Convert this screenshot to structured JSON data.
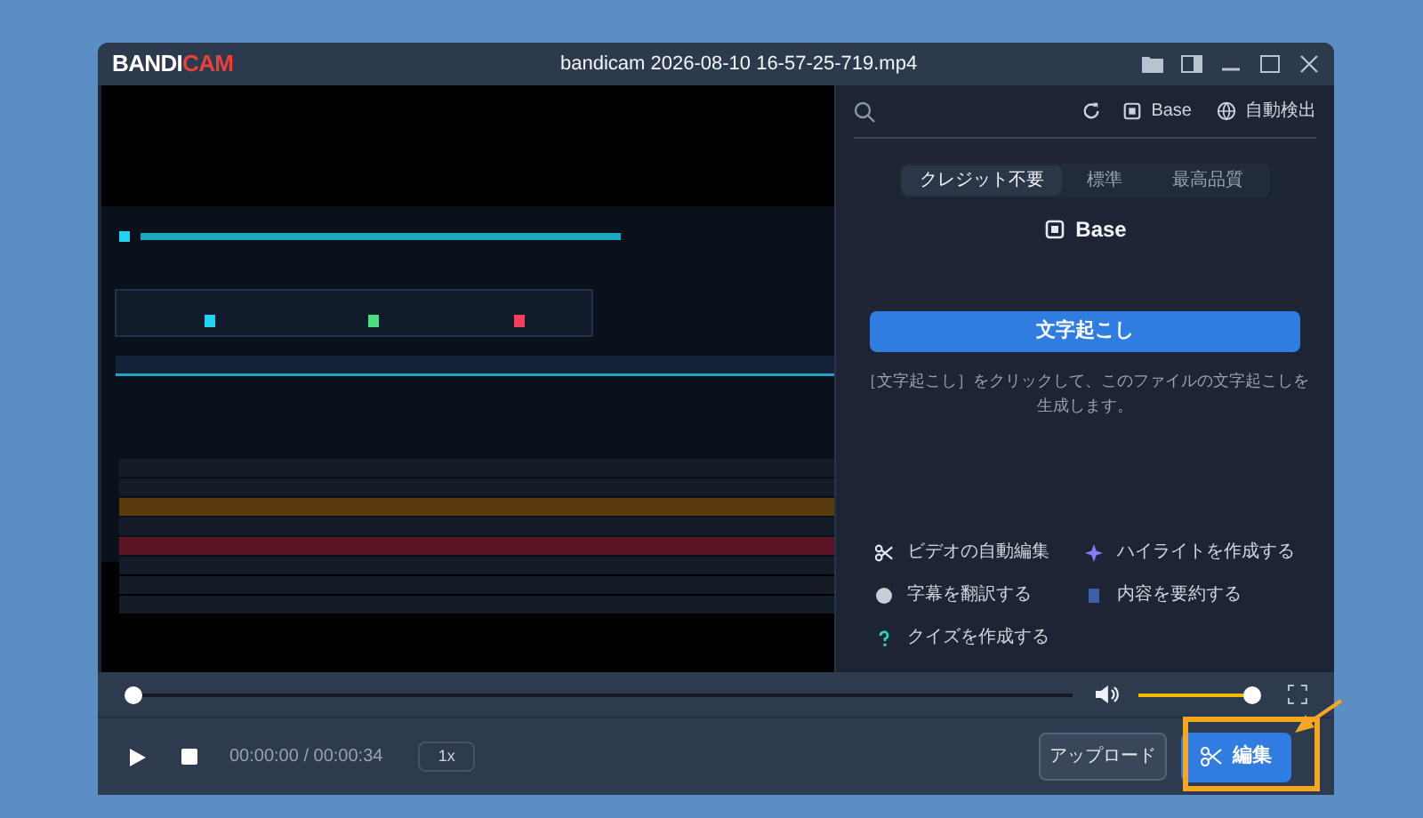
{
  "window": {
    "logo_main": "BANDI",
    "logo_accent": "CAM",
    "title": "bandicam 2026-08-10 16-57-25-719.mp4"
  },
  "side_panel": {
    "model": "Base",
    "language": "自動検出",
    "tabs": [
      {
        "label": "クレジット不要",
        "selected": true
      },
      {
        "label": "標準",
        "selected": false
      },
      {
        "label": "最高品質",
        "selected": false
      }
    ],
    "model_label": "Base",
    "transcribe_button": "文字起こし",
    "description": "［文字起こし］をクリックして、このファイルの文字起こしを生成します。",
    "features": [
      {
        "kind": "cut",
        "label": "ビデオの自動編集"
      },
      {
        "kind": "highlight",
        "label": "ハイライトを作成する"
      },
      {
        "kind": "translate",
        "label": "字幕を翻訳する"
      },
      {
        "kind": "summary",
        "label": "内容を要約する"
      },
      {
        "kind": "quiz",
        "label": "クイズを作成する"
      }
    ]
  },
  "player": {
    "progress": {
      "level": 0
    },
    "volume": {
      "level": 0.97
    },
    "time": "00:00:00 / 00:00:34",
    "speed": "1x",
    "upload_button": "アップロード",
    "edit_button": "編集",
    "edit_highlighted": true
  }
}
